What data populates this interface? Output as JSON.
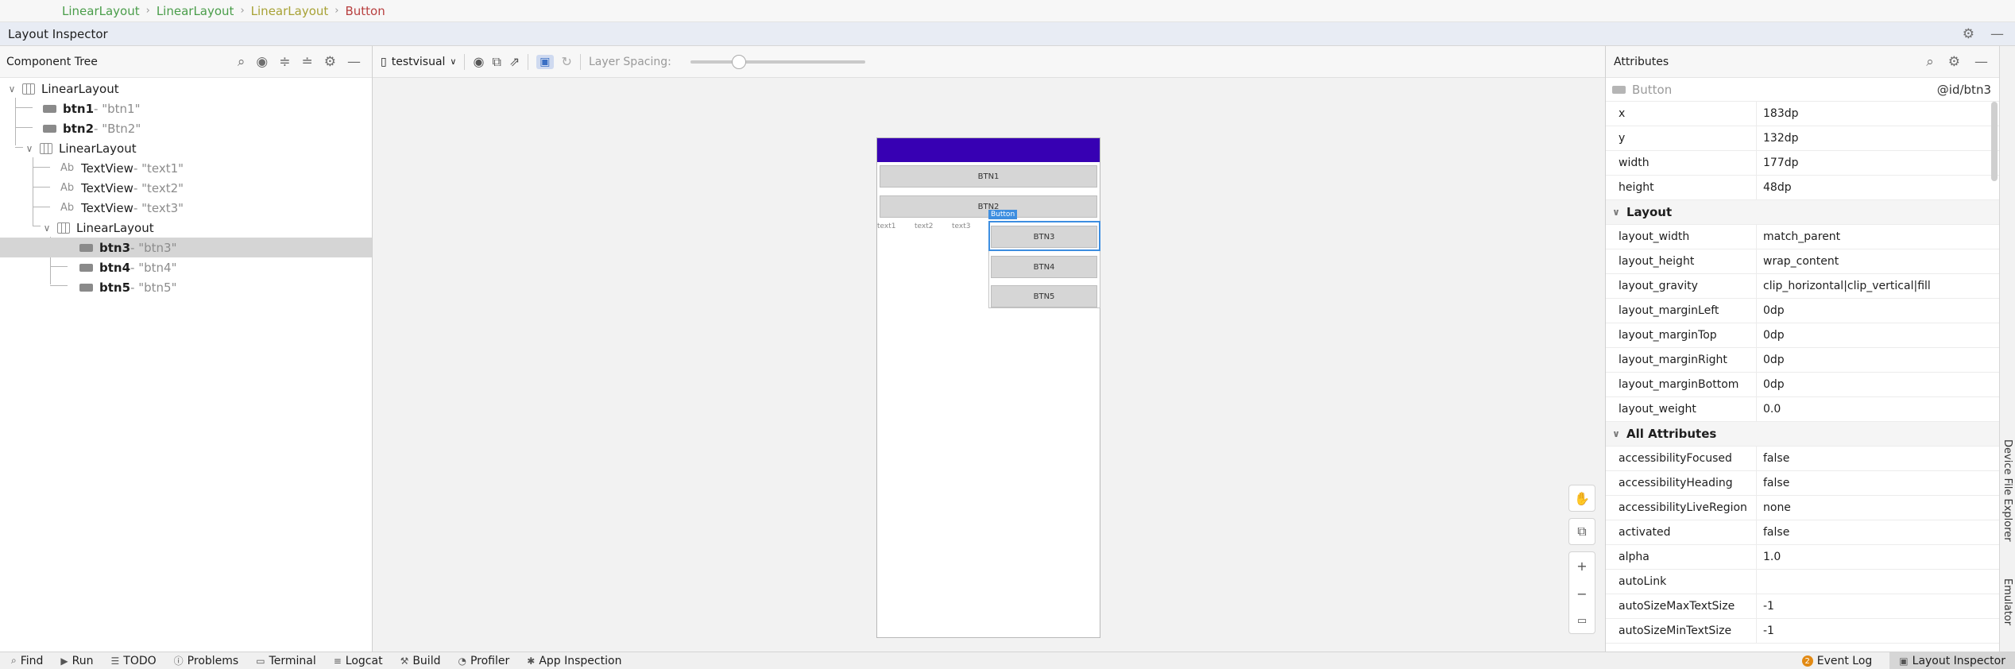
{
  "breadcrumb": [
    "LinearLayout",
    "LinearLayout",
    "LinearLayout",
    "Button"
  ],
  "layout_inspector_title": "Layout Inspector",
  "tree": {
    "title": "Component Tree",
    "rows": [
      {
        "name": "LinearLayout",
        "sub": ""
      },
      {
        "name": "btn1",
        "sub": " - \"btn1\""
      },
      {
        "name": "btn2",
        "sub": " - \"Btn2\""
      },
      {
        "name": "LinearLayout",
        "sub": ""
      },
      {
        "name": "TextView",
        "sub": " - \"text1\""
      },
      {
        "name": "TextView",
        "sub": " - \"text2\""
      },
      {
        "name": "TextView",
        "sub": " - \"text3\""
      },
      {
        "name": "LinearLayout",
        "sub": ""
      },
      {
        "name": "btn3",
        "sub": " - \"btn3\""
      },
      {
        "name": "btn4",
        "sub": " - \"btn4\""
      },
      {
        "name": "btn5",
        "sub": " - \"btn5\""
      }
    ]
  },
  "toolbar": {
    "device": "testvisual",
    "layer_spacing_label": "Layer Spacing:",
    "layer_spacing_value": 0.28
  },
  "preview": {
    "btn1": "BTN1",
    "btn2": "BTN2",
    "text1": "text1",
    "text2": "text2",
    "text3": "text3",
    "btn3": "BTN3",
    "btn4": "BTN4",
    "btn5": "BTN5",
    "selected_tag": "Button",
    "app_bar_color": "#3700b3",
    "selection_color": "#3d8ee0"
  },
  "attributes": {
    "title": "Attributes",
    "class_name": "Button",
    "view_id": "@id/btn3",
    "top_rows": [
      {
        "name": "x",
        "value": "183dp"
      },
      {
        "name": "y",
        "value": "132dp"
      },
      {
        "name": "width",
        "value": "177dp"
      },
      {
        "name": "height",
        "value": "48dp"
      }
    ],
    "layout_section": "Layout",
    "layout_rows": [
      {
        "name": "layout_width",
        "value": "match_parent"
      },
      {
        "name": "layout_height",
        "value": "wrap_content"
      },
      {
        "name": "layout_gravity",
        "value": "clip_horizontal|clip_vertical|fill"
      },
      {
        "name": "layout_marginLeft",
        "value": "0dp"
      },
      {
        "name": "layout_marginTop",
        "value": "0dp"
      },
      {
        "name": "layout_marginRight",
        "value": "0dp"
      },
      {
        "name": "layout_marginBottom",
        "value": "0dp"
      },
      {
        "name": "layout_weight",
        "value": "0.0"
      }
    ],
    "all_section": "All Attributes",
    "all_rows": [
      {
        "name": "accessibilityFocused",
        "value": "false"
      },
      {
        "name": "accessibilityHeading",
        "value": "false"
      },
      {
        "name": "accessibilityLiveRegion",
        "value": "none"
      },
      {
        "name": "activated",
        "value": "false"
      },
      {
        "name": "alpha",
        "value": "1.0"
      },
      {
        "name": "autoLink",
        "value": ""
      },
      {
        "name": "autoSizeMaxTextSize",
        "value": "-1"
      },
      {
        "name": "autoSizeMinTextSize",
        "value": "-1"
      }
    ]
  },
  "side_tabs": [
    "Device File Explorer",
    "Emulator"
  ],
  "status_bar": {
    "left": [
      "Find",
      "Run",
      "TODO",
      "Problems",
      "Terminal",
      "Logcat",
      "Build",
      "Profiler",
      "App Inspection"
    ],
    "event_log": "Event Log",
    "event_count": "2",
    "layout_inspector": "Layout Inspector"
  }
}
